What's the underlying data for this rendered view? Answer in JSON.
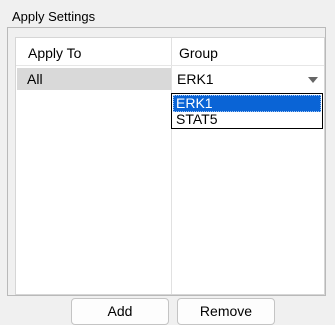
{
  "group_box": {
    "title": "Apply Settings"
  },
  "table": {
    "columns": [
      "Apply To",
      "Group"
    ],
    "rows": [
      {
        "apply_to": "All",
        "group": "ERK1"
      }
    ]
  },
  "dropdown": {
    "options": [
      "ERK1",
      "STAT5"
    ],
    "selected": "ERK1"
  },
  "buttons": {
    "add_label": "Add",
    "remove_label": "Remove"
  },
  "colors": {
    "selection": "#0a64d6",
    "row_highlight": "#d9d9d9",
    "background": "#f0f0f0"
  },
  "icons": {
    "combo_arrow": "chevron-down-icon"
  }
}
